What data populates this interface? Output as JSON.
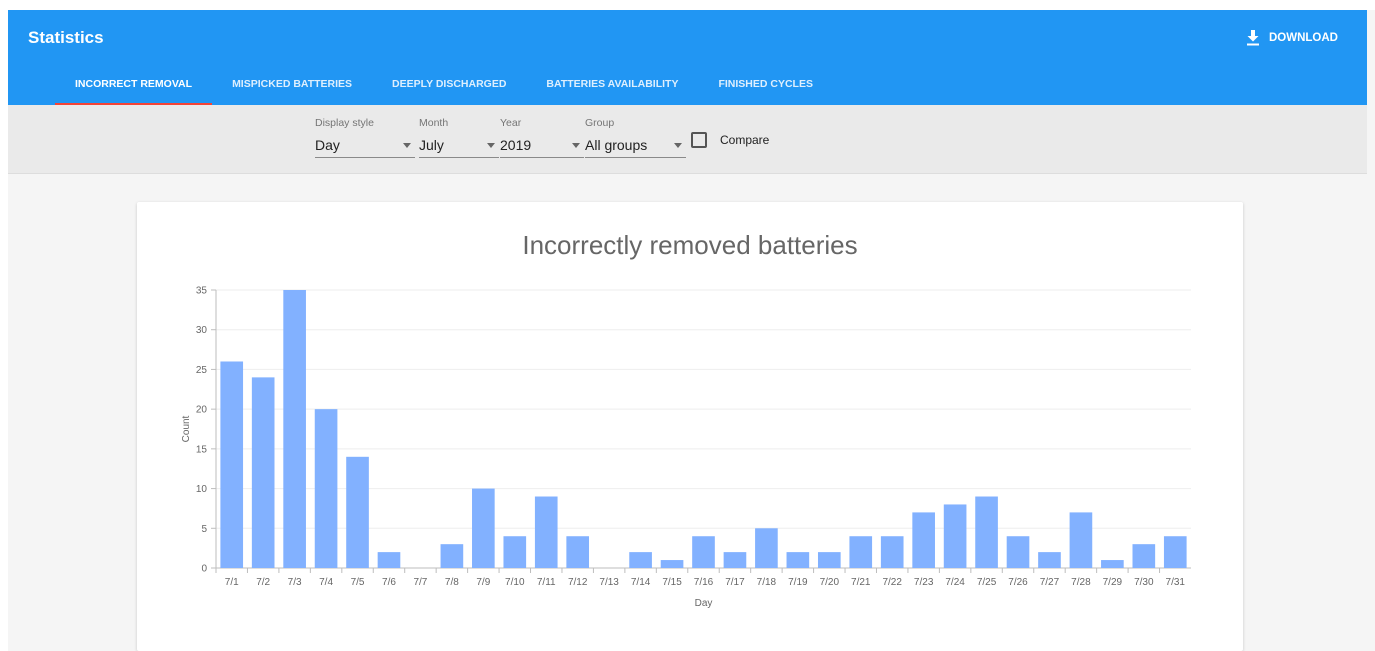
{
  "app": {
    "title": "Statistics",
    "download_label": "DOWNLOAD",
    "download_icon": "download-icon",
    "accent": "#2196f3",
    "tab_indicator": "#f44336"
  },
  "tabs": [
    {
      "label": "INCORRECT REMOVAL",
      "active": true
    },
    {
      "label": "MISPICKED BATTERIES",
      "active": false
    },
    {
      "label": "DEEPLY DISCHARGED",
      "active": false
    },
    {
      "label": "BATTERIES AVAILABILITY",
      "active": false
    },
    {
      "label": "FINISHED CYCLES",
      "active": false
    }
  ],
  "filters": {
    "display_style": {
      "label": "Display style",
      "value": "Day"
    },
    "month": {
      "label": "Month",
      "value": "July"
    },
    "year": {
      "label": "Year",
      "value": "2019"
    },
    "group": {
      "label": "Group",
      "value": "All groups"
    },
    "compare": {
      "label": "Compare",
      "checked": false
    }
  },
  "chart_data": {
    "type": "bar",
    "title": "Incorrectly removed batteries",
    "xlabel": "Day",
    "ylabel": "Count",
    "ylim": [
      0,
      35
    ],
    "yticks": [
      0,
      5,
      10,
      15,
      20,
      25,
      30,
      35
    ],
    "grid": true,
    "bar_color": "#82b1ff",
    "categories": [
      "7/1",
      "7/2",
      "7/3",
      "7/4",
      "7/5",
      "7/6",
      "7/7",
      "7/8",
      "7/9",
      "7/10",
      "7/11",
      "7/12",
      "7/13",
      "7/14",
      "7/15",
      "7/16",
      "7/17",
      "7/18",
      "7/19",
      "7/20",
      "7/21",
      "7/22",
      "7/23",
      "7/24",
      "7/25",
      "7/26",
      "7/27",
      "7/28",
      "7/29",
      "7/30",
      "7/31"
    ],
    "values": [
      26,
      24,
      35,
      20,
      14,
      2,
      0,
      3,
      10,
      4,
      9,
      4,
      0,
      2,
      1,
      4,
      2,
      5,
      2,
      2,
      4,
      4,
      7,
      8,
      9,
      4,
      2,
      7,
      1,
      3,
      4
    ]
  }
}
